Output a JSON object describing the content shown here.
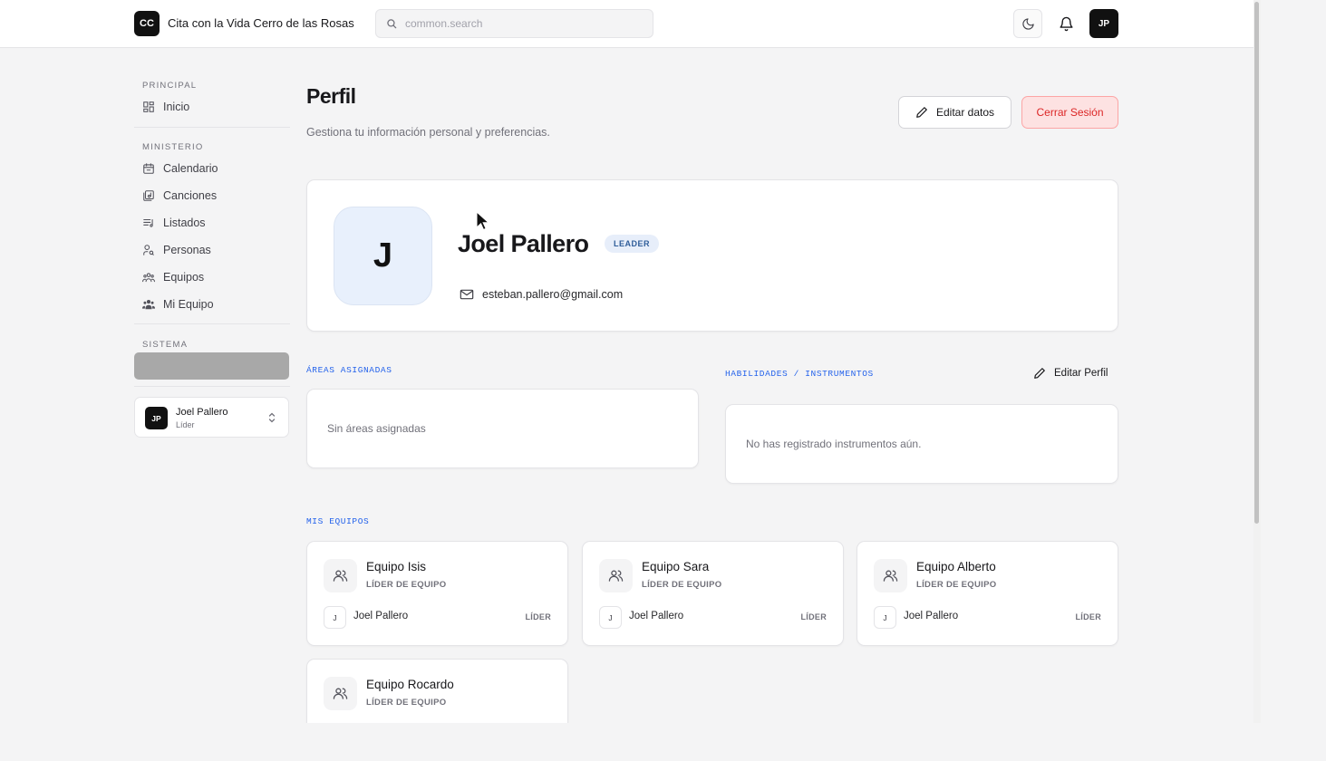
{
  "topbar": {
    "logo_initials": "CC",
    "brand_name": "Cita con la Vida Cerro de las Rosas",
    "search_placeholder": "common.search",
    "user_initials": "JP"
  },
  "sidebar": {
    "sections": [
      {
        "title": "PRINCIPAL",
        "items": [
          {
            "label": "Inicio",
            "icon": "dashboard-icon"
          }
        ]
      },
      {
        "title": "MINISTERIO",
        "items": [
          {
            "label": "Calendario",
            "icon": "calendar-icon"
          },
          {
            "label": "Canciones",
            "icon": "songs-icon"
          },
          {
            "label": "Listados",
            "icon": "playlist-icon"
          },
          {
            "label": "Personas",
            "icon": "people-search-icon"
          },
          {
            "label": "Equipos",
            "icon": "teams-icon"
          },
          {
            "label": "Mi Equipo",
            "icon": "my-team-icon"
          }
        ]
      },
      {
        "title": "SISTEMA",
        "items": []
      }
    ],
    "user": {
      "initials": "JP",
      "name": "Joel Pallero",
      "role": "Líder"
    }
  },
  "page": {
    "title": "Perfil",
    "subtitle": "Gestiona tu información personal y preferencias.",
    "edit_button": "Editar datos",
    "logout_button": "Cerrar Sesión"
  },
  "profile": {
    "avatar_letter": "J",
    "name": "Joel Pallero",
    "role_badge": "LEADER",
    "email": "esteban.pallero@gmail.com"
  },
  "areas": {
    "title": "ÁREAS ASIGNADAS",
    "empty": "Sin áreas asignadas"
  },
  "skills": {
    "title": "HABILIDADES / INSTRUMENTOS",
    "edit_label": "Editar Perfil",
    "empty": "No has registrado instrumentos aún."
  },
  "teams": {
    "title": "MIS EQUIPOS",
    "items": [
      {
        "name": "Equipo Isis",
        "role": "LÍDER DE EQUIPO",
        "member_initial": "J",
        "member_name": "Joel Pallero",
        "member_role": "LÍDER"
      },
      {
        "name": "Equipo Sara",
        "role": "LÍDER DE EQUIPO",
        "member_initial": "J",
        "member_name": "Joel Pallero",
        "member_role": "LÍDER"
      },
      {
        "name": "Equipo Alberto",
        "role": "LÍDER DE EQUIPO",
        "member_initial": "J",
        "member_name": "Joel Pallero",
        "member_role": "LÍDER"
      },
      {
        "name": "Equipo Rocardo",
        "role": "LÍDER DE EQUIPO"
      }
    ]
  },
  "colors": {
    "accent_blue": "#2563eb",
    "danger": "#dc2626",
    "danger_bg": "#fde2e2",
    "avatar_bg": "#e8f0fc"
  }
}
